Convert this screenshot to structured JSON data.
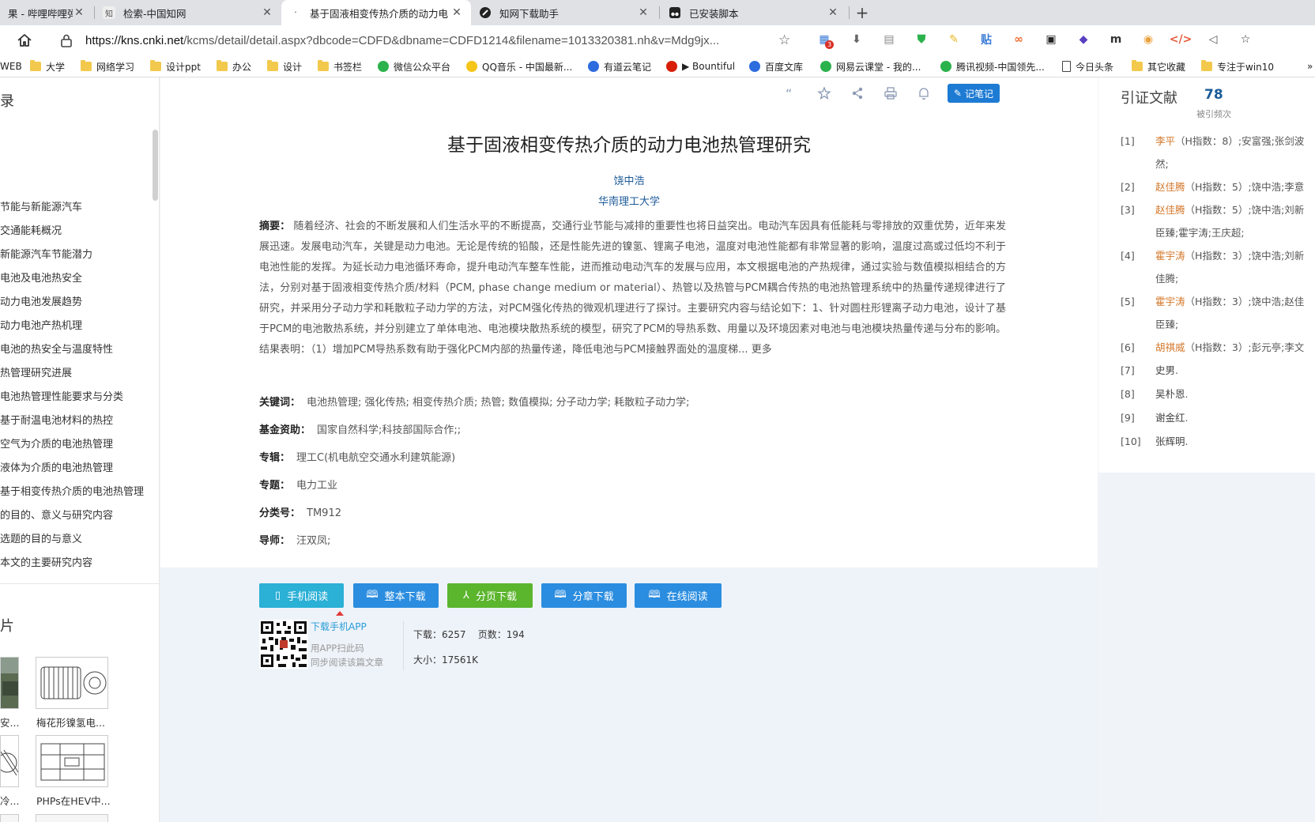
{
  "browser": {
    "tabs": [
      {
        "title": "果 - 哔哩哔哩弹幕",
        "active": false
      },
      {
        "title": "检索-中国知网",
        "active": false
      },
      {
        "title": "基于固液相变传热介质的动力电",
        "active": true
      },
      {
        "title": "知网下载助手",
        "active": false
      },
      {
        "title": "已安装脚本",
        "active": false
      }
    ],
    "url_host": "https://kns.cnki.net",
    "url_path": "/kcms/detail/detail.aspx?dbcode=CDFD&dbname=CDFD1214&filename=1013320381.nh&v=Mdg9jx...",
    "extension_badge": "3",
    "extensions": [
      {
        "name": "apps-icon",
        "color": "#3a7bd5"
      },
      {
        "name": "download-icon",
        "color": "#666666"
      },
      {
        "name": "reader-icon",
        "color": "#888888"
      },
      {
        "name": "shield-icon",
        "color": "#2bb24c"
      },
      {
        "name": "note-icon",
        "color": "#e8b923"
      },
      {
        "name": "tieba-icon",
        "color": "#3a7bd5"
      },
      {
        "name": "infinity-icon",
        "color": "#f06b2a"
      },
      {
        "name": "qr-icon",
        "color": "#222222"
      },
      {
        "name": "cube-icon",
        "color": "#5a3fc0"
      },
      {
        "name": "m-icon",
        "color": "#333333"
      },
      {
        "name": "chrome-icon",
        "color": "#e9a23b"
      },
      {
        "name": "code-icon",
        "color": "#e55c3c"
      },
      {
        "name": "sound-icon",
        "color": "#555555"
      },
      {
        "name": "favorites-icon",
        "color": "#333333"
      }
    ],
    "bookmarks": [
      {
        "label": "WEB",
        "icon": "none"
      },
      {
        "label": "大学",
        "icon": "folder"
      },
      {
        "label": "网络学习",
        "icon": "folder"
      },
      {
        "label": "设计ppt",
        "icon": "folder"
      },
      {
        "label": "办公",
        "icon": "folder"
      },
      {
        "label": "设计",
        "icon": "folder"
      },
      {
        "label": "书签栏",
        "icon": "folder"
      },
      {
        "label": "微信公众平台",
        "icon": "wechat"
      },
      {
        "label": "QQ音乐 - 中国最新...",
        "icon": "qqmusic"
      },
      {
        "label": "有道云笔记",
        "icon": "youdao"
      },
      {
        "label": "▶ Bountiful",
        "icon": "netease"
      },
      {
        "label": "百度文库",
        "icon": "baidu"
      },
      {
        "label": "网易云课堂 - 我的...",
        "icon": "study"
      },
      {
        "label": "腾讯视频-中国领先...",
        "icon": "video"
      },
      {
        "label": "今日头条",
        "icon": "page"
      },
      {
        "label": "其它收藏",
        "icon": "folder"
      },
      {
        "label": "专注于win10",
        "icon": "folder"
      }
    ]
  },
  "left_sidebar": {
    "toc_heading": "录",
    "toc_items": [
      "节能与新能源汽车",
      "交通能耗概况",
      "新能源汽车节能潜力",
      "电池及电池热安全",
      "动力电池发展趋势",
      "动力电池产热机理",
      "电池的热安全与温度特性",
      "热管理研究进展",
      "电池热管理性能要求与分类",
      "基于耐温电池材料的热控",
      "空气为介质的电池热管理",
      "液体为介质的电池热管理",
      "基于相变传热介质的电池热管理",
      "的目的、意义与研究内容",
      "选题的目的与意义",
      "本文的主要研究内容"
    ],
    "figures_heading": "片",
    "figures": [
      {
        "caption": "安..."
      },
      {
        "caption": "梅花形镍氢电..."
      },
      {
        "caption": "冷..."
      },
      {
        "caption": "PHPs在HEV中..."
      }
    ]
  },
  "article": {
    "title": "基于固液相变传热介质的动力电池热管理研究",
    "author": "饶中浩",
    "institution": "华南理工大学",
    "abstract_label": "摘要：",
    "abstract_text": "随着经济、社会的不断发展和人们生活水平的不断提高，交通行业节能与减排的重要性也将日益突出。电动汽车因具有低能耗与零排放的双重优势，近年来发展迅速。发展电动汽车，关键是动力电池。无论是传统的铅酸，还是性能先进的镍氢、锂离子电池，温度对电池性能都有非常显著的影响，温度过高或过低均不利于电池性能的发挥。为延长动力电池循环寿命，提升电动汽车整车性能，进而推动电动汽车的发展与应用，本文根据电池的产热规律，通过实验与数值模拟相结合的方法，分别对基于固液相变传热介质/材料（PCM, phase change medium or material）、热管以及热管与PCM耦合传热的电池热管理系统中的热量传递规律进行了研究，并采用分子动力学和耗散粒子动力学的方法，对PCM强化传热的微观机理进行了探讨。主要研究内容与结论如下：1、针对圆柱形锂离子动力电池，设计了基于PCM的电池散热系统，并分别建立了单体电池、电池模块散热系统的模型，研究了PCM的导热系数、用量以及环境因素对电池与电池模块热量传递与分布的影响。结果表明：（1）增加PCM导热系数有助于强化PCM内部的热量传递，降低电池与PCM接触界面处的温度梯...",
    "more_label": "更多",
    "fields": [
      {
        "label": "关键词：",
        "value": "电池热管理;  强化传热;  相变传热介质;  热管;  数值模拟;  分子动力学;  耗散粒子动力学;"
      },
      {
        "label": "基金资助：",
        "value": "国家自然科学;科技部国际合作;;"
      },
      {
        "label": "专辑：",
        "value": "理工C(机电航空交通水利建筑能源)"
      },
      {
        "label": "专题：",
        "value": "电力工业"
      },
      {
        "label": "分类号：",
        "value": "TM912"
      },
      {
        "label": "导师：",
        "value": "汪双凤;"
      }
    ],
    "note_button": "记笔记"
  },
  "download": {
    "buttons": [
      {
        "label": "手机阅读",
        "color": "#2bb0d6"
      },
      {
        "label": "整本下载",
        "color": "#2b8de0"
      },
      {
        "label": "分页下载",
        "color": "#5bb52d"
      },
      {
        "label": "分章下载",
        "color": "#2b8de0"
      },
      {
        "label": "在线阅读",
        "color": "#2b8de0"
      }
    ],
    "app_link": "下载手机APP",
    "app_tip1": "用APP扫此码",
    "app_tip2": "同步阅读该篇文章",
    "stats_line1": "下载：6257    页数：194",
    "stats_line2": "大小：17561K"
  },
  "citations": {
    "heading": "引证文献",
    "count": "78",
    "count_label": "被引频次",
    "refs": [
      {
        "num": "[1]",
        "name": "李平",
        "h": "（H指数：8）",
        "rest": ";安富强;张剑波",
        "highlight": true
      },
      {
        "num": "",
        "name": "",
        "h": "",
        "rest": "然;",
        "highlight": false
      },
      {
        "num": "[2]",
        "name": "赵佳腾",
        "h": "（H指数：5）",
        "rest": ";饶中浩;李意",
        "highlight": true
      },
      {
        "num": "[3]",
        "name": "赵佳腾",
        "h": "（H指数：5）",
        "rest": ";饶中浩;刘新",
        "highlight": true
      },
      {
        "num": "",
        "name": "",
        "h": "",
        "rest": "臣臻;霍宇涛;王庆超;",
        "highlight": false
      },
      {
        "num": "[4]",
        "name": "霍宇涛",
        "h": "（H指数：3）",
        "rest": ";饶中浩;刘新",
        "highlight": true
      },
      {
        "num": "",
        "name": "",
        "h": "",
        "rest": "佳腾;",
        "highlight": false
      },
      {
        "num": "[5]",
        "name": "霍宇涛",
        "h": "（H指数：3）",
        "rest": ";饶中浩;赵佳",
        "highlight": true
      },
      {
        "num": "",
        "name": "",
        "h": "",
        "rest": "臣臻;",
        "highlight": false
      },
      {
        "num": "[6]",
        "name": "胡祺威",
        "h": "（H指数：3）",
        "rest": ";彭元亭;李文",
        "highlight": true
      },
      {
        "num": "[7]",
        "name": "史男",
        "h": "",
        "rest": ".",
        "highlight": false
      },
      {
        "num": "[8]",
        "name": "吴朴恩",
        "h": "",
        "rest": ".",
        "highlight": false
      },
      {
        "num": "[9]",
        "name": "谢金红",
        "h": "",
        "rest": ".",
        "highlight": false
      },
      {
        "num": "[10]",
        "name": "张辉明",
        "h": "",
        "rest": ".",
        "highlight": false
      }
    ]
  }
}
